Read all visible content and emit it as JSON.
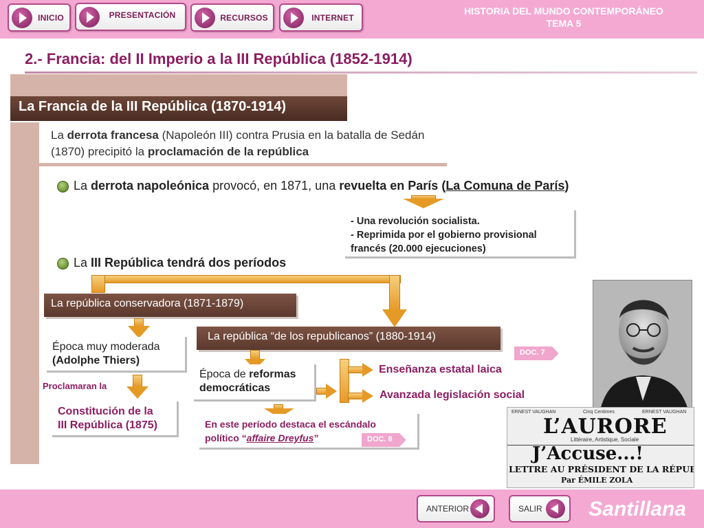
{
  "nav": {
    "inicio": "INICIO",
    "presentacion": "PRESENTACIÓN",
    "recursos": "RECURSOS",
    "internet": "INTERNET"
  },
  "course": {
    "line1": "HISTORIA DEL MUNDO CONTEMPORÁNEO",
    "line2": "TEMA 5"
  },
  "page_title": "2.- Francia: del II Imperio a la III República (1852-1914)",
  "section_heading": "La Francia de la III República (1870-1914)",
  "intro": {
    "p1": "La ",
    "p1b": "derrota francesa",
    "p2": " (Napoleón III) contra Prusia en la batalla de Sedán (1870) precipitó la ",
    "p2b": "proclamación de la república"
  },
  "point1": {
    "a": "La ",
    "b": "derrota napoleónica",
    "c": " provocó, en 1871, una ",
    "d": "revuelta en París",
    "e": " (",
    "f": "La Comuna de París",
    "g": ")"
  },
  "comuna_note": {
    "line1": "- Una revolución socialista.",
    "line2": "- Reprimida por el gobierno provisional",
    "line3": "francés (20.000 ejecuciones)"
  },
  "point2": {
    "a": "La ",
    "b": "III República tendrá dos períodos"
  },
  "period1": {
    "label": "La república conservadora (1871-1879)",
    "epoch_a": "Época muy moderada",
    "epoch_b": "(Adolphe Thiers)",
    "proclaim": "Proclamaran la",
    "constitution_1": "Constitución de la",
    "constitution_2": "III República (1875)"
  },
  "period2": {
    "label": "La república “de los republicanos” (1880-1914)",
    "epoch_a": "Época de ",
    "epoch_b": "reformas",
    "epoch_c": "democráticas",
    "result1": "Enseñanza estatal laica",
    "result2": "Avanzada legislación social",
    "dreyfus_1": "En este período destaca el escándalo",
    "dreyfus_2a": "político  “",
    "dreyfus_2b": "affaire Dreyfus",
    "dreyfus_2c": "”"
  },
  "docs": {
    "doc7": "DOC. 7",
    "doc8": "DOC. 8"
  },
  "newspaper": {
    "masthead": "L’AURORE",
    "sub": "Littéraire, Artistique, Sociale",
    "headline": "J’Accuse...!",
    "line": "LETTRE AU PRÉSIDENT DE LA RÉPUBLIQUE",
    "byline": "Par ÉMILE ZOLA",
    "top_left_1": "ERNEST VAUGHAN",
    "top_right_1": "ERNEST VAUGHAN",
    "date_small": "Cinq Centimes"
  },
  "footer": {
    "anterior": "ANTERIOR",
    "salir": "SALIR",
    "brand": "Santillana"
  },
  "colors": {
    "pink_bar": "#f4a9d3",
    "title_magenta": "#8b1d60",
    "brown": "#5b392d",
    "tan": "#d6b3a9",
    "orange": "#e59a26"
  }
}
